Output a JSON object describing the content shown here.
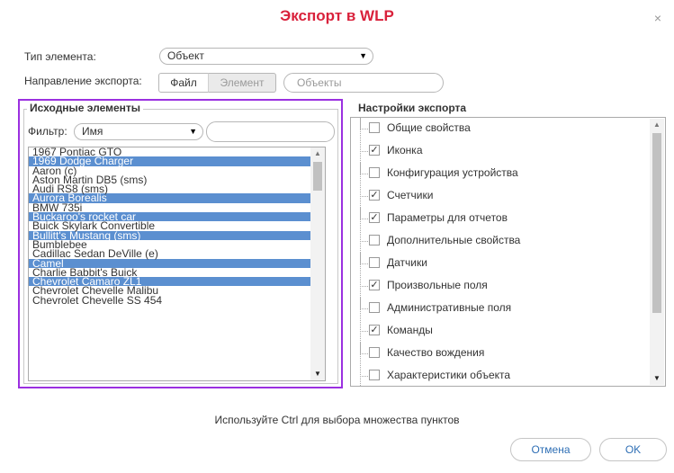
{
  "dialog": {
    "title": "Экспорт в WLP",
    "close": "×"
  },
  "form": {
    "type_label": "Тип элемента:",
    "type_value": "Объект",
    "direction_label": "Направление экспорта:",
    "seg_file": "Файл",
    "seg_element": "Элемент",
    "objects_placeholder": "Объекты"
  },
  "source": {
    "legend": "Исходные элементы",
    "filter_label": "Фильтр:",
    "filter_value": "Имя",
    "items": [
      {
        "label": "1967 Pontiac GTO",
        "selected": false
      },
      {
        "label": "1969 Dodge Charger",
        "selected": true
      },
      {
        "label": "Aaron (c)",
        "selected": false
      },
      {
        "label": "Aston Martin DB5 (sms)",
        "selected": false
      },
      {
        "label": "Audi RS8 (sms)",
        "selected": false
      },
      {
        "label": "Aurora Borealis",
        "selected": true
      },
      {
        "label": "BMW 735i",
        "selected": false
      },
      {
        "label": "Buckaroo's rocket car",
        "selected": true
      },
      {
        "label": "Buick Skylark Convertible",
        "selected": false
      },
      {
        "label": "Bullitt's Mustang (sms)",
        "selected": true
      },
      {
        "label": "Bumblebee",
        "selected": false
      },
      {
        "label": "Cadillac Sedan DeVille (e)",
        "selected": false
      },
      {
        "label": "Camel",
        "selected": true
      },
      {
        "label": "Charlie Babbit's Buick",
        "selected": false
      },
      {
        "label": "Chevrolet Camaro ZL1",
        "selected": true
      },
      {
        "label": "Chevrolet Chevelle Malibu",
        "selected": false
      },
      {
        "label": "Chevrolet Chevelle SS 454",
        "selected": false
      }
    ]
  },
  "settings": {
    "legend": "Настройки экспорта",
    "items": [
      {
        "label": "Общие свойства",
        "checked": false
      },
      {
        "label": "Иконка",
        "checked": true
      },
      {
        "label": "Конфигурация устройства",
        "checked": false
      },
      {
        "label": "Счетчики",
        "checked": true
      },
      {
        "label": "Параметры для отчетов",
        "checked": true
      },
      {
        "label": "Дополнительные свойства",
        "checked": false
      },
      {
        "label": "Датчики",
        "checked": false
      },
      {
        "label": "Произвольные поля",
        "checked": true
      },
      {
        "label": "Административные поля",
        "checked": false
      },
      {
        "label": "Команды",
        "checked": true
      },
      {
        "label": "Качество вождения",
        "checked": false
      },
      {
        "label": "Характеристики объекта",
        "checked": false
      }
    ]
  },
  "footer": {
    "hint": "Используйте Ctrl для выбора множества пунктов",
    "cancel": "Отмена",
    "ok": "OK"
  },
  "colors": {
    "title": "#d9213b",
    "selection": "#5b8fd0",
    "highlight_frame": "#9b30e0",
    "button_text": "#2f6fb5"
  }
}
